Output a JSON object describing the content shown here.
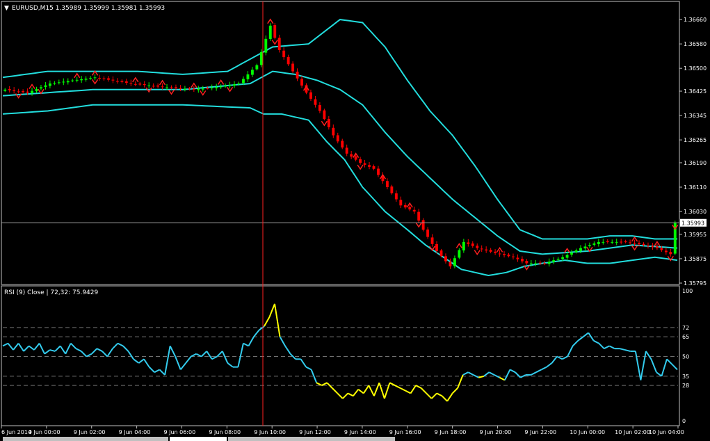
{
  "colors": {
    "background": "#000000",
    "frame": "#c0c0c0",
    "bull": "#00ff00",
    "bear": "#ff0000",
    "band": "#22dddd",
    "fractal": "#ff2020",
    "crosshair": "#ff2020",
    "rsi": "#33ccee",
    "rsi_extreme": "#ffff00",
    "price_label_bg": "#ffffff",
    "price_label_fg": "#000000",
    "tab_bg": "#c0c0c0"
  },
  "main": {
    "title": "EURUSD,M15  1.35989 1.35999 1.35981 1.35993",
    "current_price": "1.35993"
  },
  "rsi_panel": {
    "title": "RSI (9) Close | 72,32: 75.9429"
  },
  "chart_data": [
    {
      "type": "candlestick",
      "symbol": "EURUSD",
      "timeframe": "M15",
      "ohlc": {
        "open": 1.35989,
        "high": 1.35999,
        "low": 1.35981,
        "close": 1.35993
      },
      "ylim": [
        1.35795,
        1.36715
      ],
      "y_ticks": [
        1.3666,
        1.3658,
        1.365,
        1.36425,
        1.36345,
        1.36265,
        1.3619,
        1.3611,
        1.3603,
        1.35955,
        1.35875,
        1.35795
      ],
      "y_tick_labels": [
        "1.36660",
        "1.36580",
        "1.36500",
        "1.36425",
        "1.36345",
        "1.36265",
        "1.36190",
        "1.36110",
        "1.36030",
        "1.35955",
        "1.35875",
        "1.35795"
      ],
      "current_price": 1.35993,
      "x_labels": [
        "6 Jun 2014",
        "9 Jun 00:00",
        "9 Jun 02:00",
        "9 Jun 04:00",
        "9 Jun 06:00",
        "9 Jun 08:00",
        "9 Jun 10:00",
        "9 Jun 12:00",
        "9 Jun 14:00",
        "9 Jun 16:00",
        "9 Jun 18:00",
        "9 Jun 20:00",
        "9 Jun 22:00",
        "10 Jun 00:00",
        "10 Jun 02:00",
        "10 Jun 04:00"
      ],
      "anchors": [
        [
          0,
          1.3643
        ],
        [
          5,
          1.3642
        ],
        [
          10,
          1.3645
        ],
        [
          15,
          1.3646
        ],
        [
          20,
          1.3647
        ],
        [
          28,
          1.3645
        ],
        [
          34,
          1.3644
        ],
        [
          42,
          1.3643
        ],
        [
          48,
          1.3644
        ],
        [
          52,
          1.3645
        ],
        [
          56,
          1.3651
        ],
        [
          59,
          1.3664
        ],
        [
          61,
          1.3656
        ],
        [
          64,
          1.3649
        ],
        [
          67,
          1.3642
        ],
        [
          70,
          1.3636
        ],
        [
          73,
          1.3628
        ],
        [
          76,
          1.3622
        ],
        [
          79,
          1.3619
        ],
        [
          82,
          1.3617
        ],
        [
          85,
          1.3611
        ],
        [
          88,
          1.3605
        ],
        [
          91,
          1.3603
        ],
        [
          93,
          1.3597
        ],
        [
          96,
          1.359
        ],
        [
          99,
          1.3585
        ],
        [
          102,
          1.3593
        ],
        [
          105,
          1.3591
        ],
        [
          110,
          1.3589
        ],
        [
          113,
          1.3588
        ],
        [
          116,
          1.3586
        ],
        [
          120,
          1.3586
        ],
        [
          124,
          1.3588
        ],
        [
          128,
          1.3591
        ],
        [
          132,
          1.3593
        ],
        [
          138,
          1.3593
        ],
        [
          142,
          1.3592
        ],
        [
          145,
          1.3591
        ],
        [
          148,
          1.3589
        ],
        [
          150,
          1.3588
        ]
      ],
      "bollinger_bands": {
        "upper": [
          [
            0,
            1.3647
          ],
          [
            10,
            1.3649
          ],
          [
            20,
            1.3649
          ],
          [
            30,
            1.3649
          ],
          [
            40,
            1.3648
          ],
          [
            50,
            1.3649
          ],
          [
            60,
            1.3657
          ],
          [
            68,
            1.3658
          ],
          [
            75,
            1.3666
          ],
          [
            80,
            1.3665
          ],
          [
            85,
            1.3657
          ],
          [
            90,
            1.3646
          ],
          [
            95,
            1.3636
          ],
          [
            100,
            1.3628
          ],
          [
            105,
            1.3618
          ],
          [
            110,
            1.3607
          ],
          [
            115,
            1.3597
          ],
          [
            120,
            1.3594
          ],
          [
            125,
            1.3594
          ],
          [
            130,
            1.3594
          ],
          [
            135,
            1.3595
          ],
          [
            140,
            1.3595
          ],
          [
            145,
            1.3594
          ],
          [
            150,
            1.3594
          ]
        ],
        "middle": [
          [
            0,
            1.3641
          ],
          [
            20,
            1.3643
          ],
          [
            40,
            1.3643
          ],
          [
            55,
            1.3645
          ],
          [
            60,
            1.3649
          ],
          [
            65,
            1.3648
          ],
          [
            70,
            1.3646
          ],
          [
            75,
            1.3643
          ],
          [
            80,
            1.3638
          ],
          [
            85,
            1.3629
          ],
          [
            90,
            1.3621
          ],
          [
            95,
            1.3614
          ],
          [
            100,
            1.3607
          ],
          [
            105,
            1.3601
          ],
          [
            110,
            1.3595
          ],
          [
            115,
            1.359
          ],
          [
            120,
            1.3589
          ],
          [
            130,
            1.359
          ],
          [
            140,
            1.3592
          ],
          [
            150,
            1.3591
          ]
        ],
        "lower": [
          [
            0,
            1.3635
          ],
          [
            10,
            1.3636
          ],
          [
            20,
            1.3638
          ],
          [
            30,
            1.3638
          ],
          [
            40,
            1.3638
          ],
          [
            55,
            1.3637
          ],
          [
            58,
            1.3635
          ],
          [
            62,
            1.3635
          ],
          [
            68,
            1.3633
          ],
          [
            72,
            1.3626
          ],
          [
            76,
            1.362
          ],
          [
            80,
            1.3611
          ],
          [
            85,
            1.3603
          ],
          [
            90,
            1.3597
          ],
          [
            94,
            1.3592
          ],
          [
            98,
            1.3588
          ],
          [
            102,
            1.3584
          ],
          [
            108,
            1.3582
          ],
          [
            112,
            1.3583
          ],
          [
            116,
            1.3585
          ],
          [
            120,
            1.3586
          ],
          [
            125,
            1.3587
          ],
          [
            130,
            1.3586
          ],
          [
            135,
            1.3586
          ],
          [
            140,
            1.3587
          ],
          [
            145,
            1.3588
          ],
          [
            150,
            1.3587
          ]
        ]
      },
      "fractals_up": [
        6,
        16,
        20,
        29,
        35,
        42,
        48,
        59,
        67,
        78,
        84,
        90,
        101,
        110,
        125,
        140,
        145
      ],
      "fractals_down": [
        3,
        8,
        20,
        32,
        37,
        44,
        50,
        60,
        71,
        79,
        92,
        95,
        105,
        116,
        130,
        140,
        148,
        149
      ]
    },
    {
      "type": "line",
      "name": "RSI (9) Close",
      "levels": [
        72,
        65,
        50,
        35,
        28
      ],
      "level_labels": [
        "72",
        "65",
        "50",
        "35",
        "28"
      ],
      "ylim": [
        0,
        100
      ],
      "y_labels": [
        "100",
        "0"
      ],
      "current_value": 75.9429,
      "values": [
        58,
        60,
        55,
        60,
        54,
        58,
        55,
        60,
        52,
        55,
        54,
        58,
        52,
        60,
        56,
        54,
        50,
        52,
        56,
        54,
        50,
        56,
        60,
        58,
        54,
        48,
        45,
        48,
        42,
        38,
        40,
        36,
        58,
        50,
        40,
        45,
        50,
        52,
        50,
        54,
        48,
        50,
        54,
        45,
        42,
        42,
        60,
        58,
        65,
        70,
        73,
        80,
        90,
        65,
        58,
        52,
        48,
        48,
        42,
        40,
        30,
        28,
        30,
        26,
        22,
        18,
        22,
        20,
        25,
        22,
        28,
        20,
        30,
        18,
        30,
        28,
        26,
        24,
        22,
        28,
        26,
        22,
        18,
        22,
        20,
        16,
        22,
        26,
        36,
        38,
        36,
        34,
        35,
        38,
        36,
        34,
        32,
        40,
        38,
        34,
        36,
        36,
        38,
        40,
        42,
        45,
        50,
        48,
        50,
        58,
        62,
        65,
        68,
        62,
        60,
        56,
        58,
        56,
        56,
        55,
        54,
        54,
        32,
        54,
        48,
        38,
        35,
        48,
        44,
        40
      ]
    }
  ]
}
